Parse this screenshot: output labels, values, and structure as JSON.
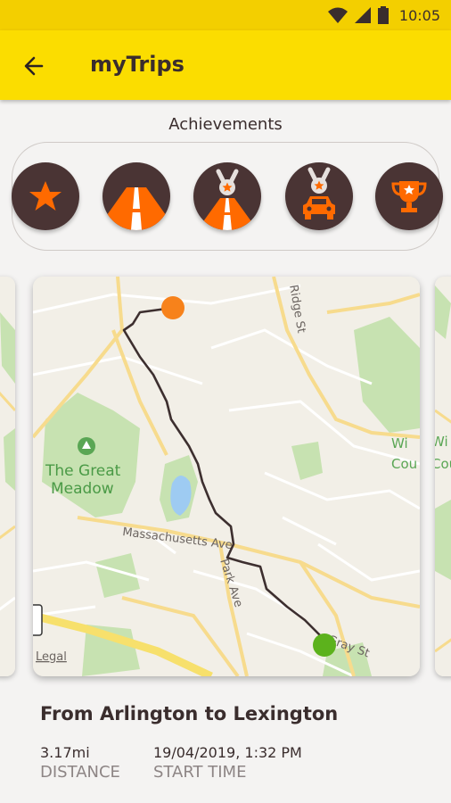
{
  "status_bar": {
    "time": "10:05",
    "icons": [
      "wifi-icon",
      "signal-icon",
      "battery-icon"
    ]
  },
  "app_bar": {
    "title": "myTrips",
    "back_icon": "arrow-left-icon"
  },
  "achievements": {
    "title": "Achievements",
    "badges": [
      "star-badge",
      "road-badge",
      "road-medal-badge",
      "car-medal-badge",
      "trophy-badge"
    ]
  },
  "map": {
    "legal": "Legal",
    "labels": {
      "great_meadow_1": "The Great",
      "great_meadow_2": "Meadow",
      "massachusetts": "Massachusetts Ave",
      "park": "Park Ave",
      "ridge": "Ridge St",
      "gray": "Gray St",
      "win1": "Wi",
      "win2": "Cou"
    }
  },
  "trip": {
    "title": "From Arlington to Lexington",
    "distance_value": "3.17mi",
    "distance_label": "DISTANCE",
    "start_value": "19/04/2019, 1:32 PM",
    "start_label": "START TIME"
  },
  "colors": {
    "yellow": "#fbdd00",
    "badge_bg": "#4a3434",
    "accent": "#ff6a00",
    "start_dot": "#f7821b",
    "end_dot": "#5cb21c"
  }
}
